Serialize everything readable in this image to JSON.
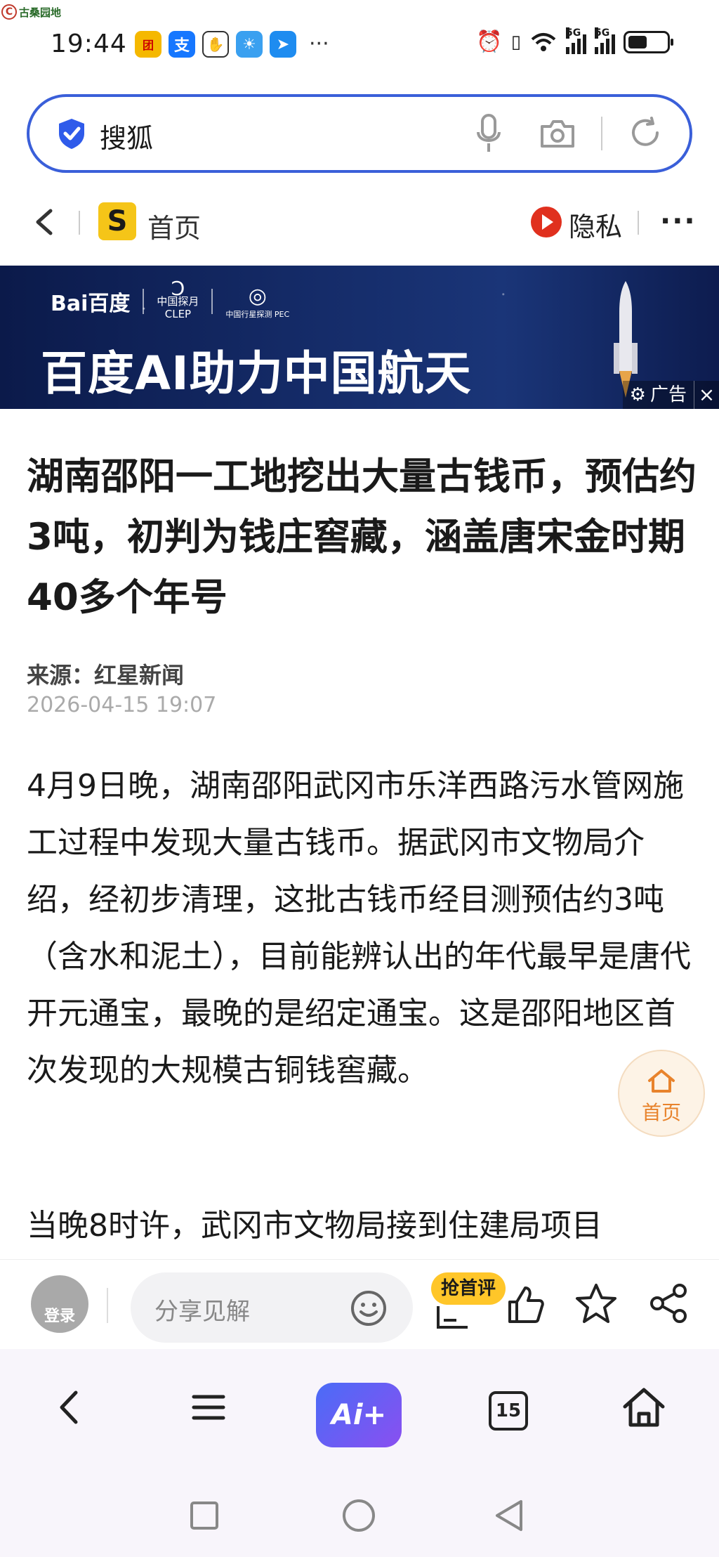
{
  "watermark": {
    "text": "古桑园地"
  },
  "status_bar": {
    "time": "19:44",
    "more": "···",
    "net1": "5G",
    "net2": "5G"
  },
  "search": {
    "query": "搜狐"
  },
  "nav": {
    "site_name": "首页",
    "privacy_label": "隐私",
    "more": "···"
  },
  "banner": {
    "brand": "Bai百度",
    "partner1_line1": "中国探月",
    "partner1_line2": "CLEP",
    "partner2": "中国行星探测 PEC",
    "title": "百度AI助力中国航天",
    "ad_label": "广告",
    "close": "×"
  },
  "article": {
    "headline": "湖南邵阳一工地挖出大量古钱币，预估约3吨，初判为钱庄窖藏，涵盖唐宋金时期40多个年号",
    "source": "来源：红星新闻",
    "date": "2026-04-15 19:07",
    "paragraph1": "4月9日晚，湖南邵阳武冈市乐洋西路污水管网施工过程中发现大量古钱币。据武冈市文物局介绍，经初步清理，这批古钱币经目测预估约3吨（含水和泥土），目前能辨认出的年代最早是唐代开元通宝，最晚的是绍定通宝。这是邵阳地区首次发现的大规模古铜钱窖藏。",
    "paragraph2": "当晚8时许，武冈市文物局接到住建局项目"
  },
  "float_home": {
    "label": "首页"
  },
  "comment_bar": {
    "login_label": "登录",
    "placeholder": "分享见解",
    "first_comment_badge": "抢首评"
  },
  "toolbar": {
    "ai_label": "Ai+",
    "tabs_count": "15"
  },
  "colors": {
    "accent": "#3a5fd9",
    "badge": "#ffc629",
    "float_home": "#e8832c"
  }
}
